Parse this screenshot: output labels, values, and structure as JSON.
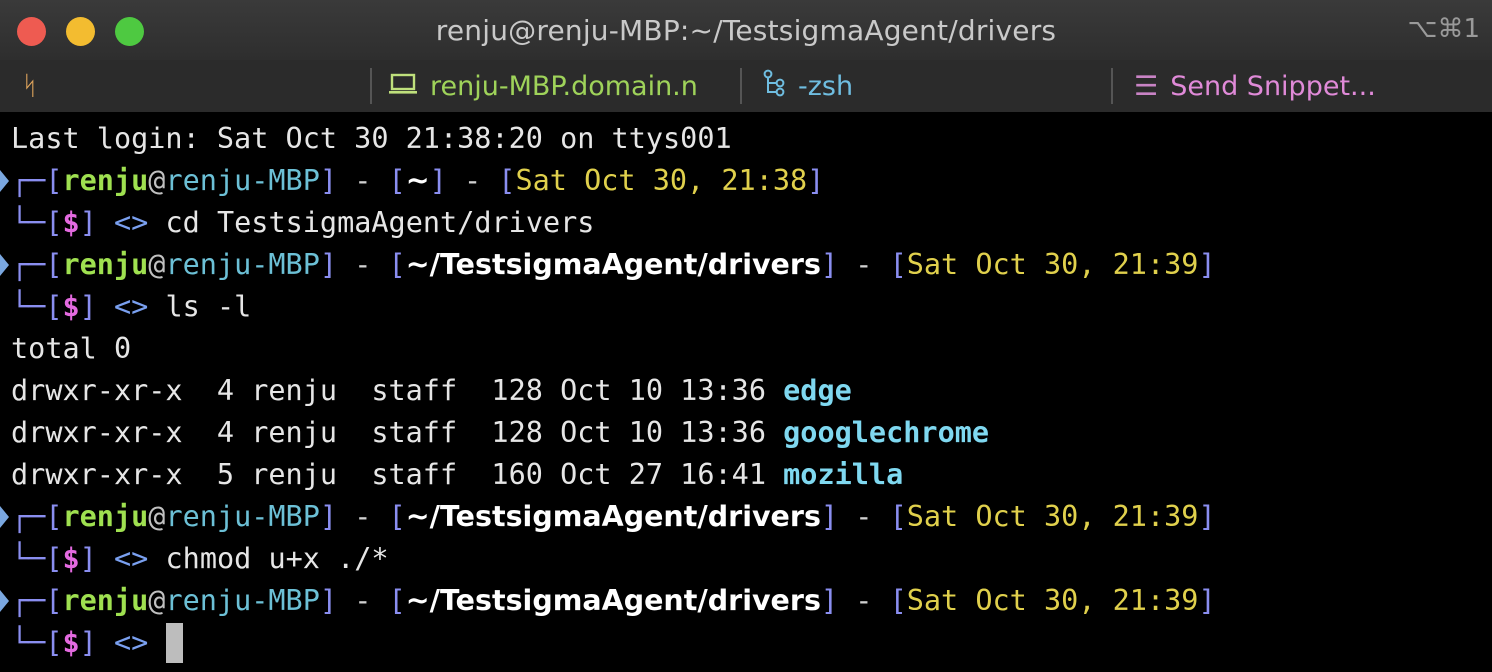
{
  "window": {
    "title": "renju@renju-MBP:~/TestsigmaAgent/drivers",
    "shortcut": "⌥⌘1"
  },
  "statusbar": {
    "host": "renju-MBP.domain.n",
    "shell": "-zsh",
    "snippet": "Send Snippet..."
  },
  "terminal": {
    "last_login": "Last login: Sat Oct 30 21:38:20 on ttys001",
    "prompts": [
      {
        "user": "renju",
        "at": "@",
        "host": "renju-MBP",
        "path": "~",
        "date": "Sat Oct 30, 21:38",
        "command": "cd TestsigmaAgent/drivers"
      },
      {
        "user": "renju",
        "at": "@",
        "host": "renju-MBP",
        "path": "~/TestsigmaAgent/drivers",
        "date": "Sat Oct 30, 21:39",
        "command": "ls -l"
      },
      {
        "user": "renju",
        "at": "@",
        "host": "renju-MBP",
        "path": "~/TestsigmaAgent/drivers",
        "date": "Sat Oct 30, 21:39",
        "command": "chmod u+x ./*"
      },
      {
        "user": "renju",
        "at": "@",
        "host": "renju-MBP",
        "path": "~/TestsigmaAgent/drivers",
        "date": "Sat Oct 30, 21:39",
        "command": ""
      }
    ],
    "ls_total": "total 0",
    "ls_rows": [
      {
        "meta": "drwxr-xr-x  4 renju  staff  128 Oct 10 13:36 ",
        "name": "edge"
      },
      {
        "meta": "drwxr-xr-x  4 renju  staff  128 Oct 10 13:36 ",
        "name": "googlechrome"
      },
      {
        "meta": "drwxr-xr-x  5 renju  staff  160 Oct 27 16:41 ",
        "name": "mozilla"
      }
    ],
    "prompt_symbol": "$",
    "prompt_arrow": "<>"
  },
  "colors": {
    "user": "#9fe050",
    "host": "#6cc0d6",
    "date": "#e0d04c",
    "dollar": "#e46ae0",
    "dir": "#7fd8f0",
    "bracket": "#8a8ef0"
  }
}
